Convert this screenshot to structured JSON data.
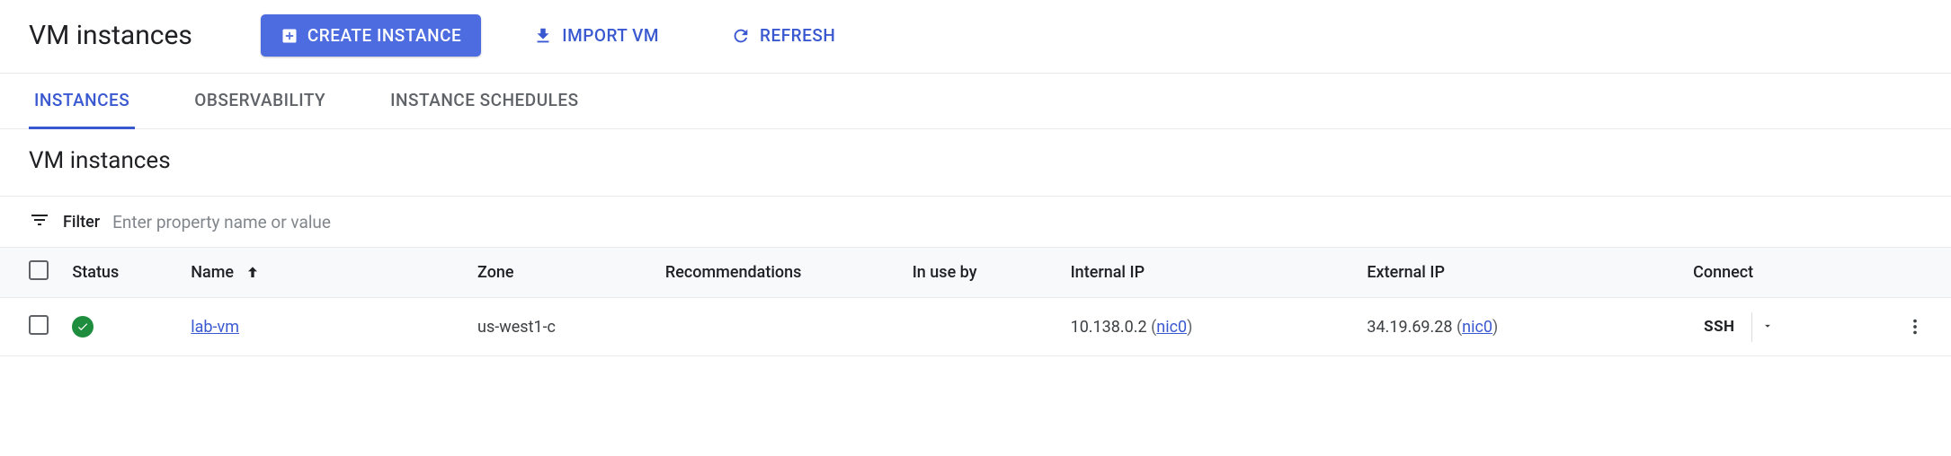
{
  "header": {
    "title": "VM instances",
    "create_label": "CREATE INSTANCE",
    "import_label": "IMPORT VM",
    "refresh_label": "REFRESH"
  },
  "tabs": {
    "instances": "INSTANCES",
    "observability": "OBSERVABILITY",
    "schedules": "INSTANCE SCHEDULES"
  },
  "subheading": "VM instances",
  "filter": {
    "label": "Filter",
    "placeholder": "Enter property name or value"
  },
  "columns": {
    "status": "Status",
    "name": "Name",
    "zone": "Zone",
    "recommendations": "Recommendations",
    "in_use_by": "In use by",
    "internal_ip": "Internal IP",
    "external_ip": "External IP",
    "connect": "Connect"
  },
  "rows": [
    {
      "status": "running",
      "name": "lab-vm",
      "zone": "us-west1-c",
      "recommendations": "",
      "in_use_by": "",
      "internal_ip": "10.138.0.2",
      "internal_nic": "nic0",
      "external_ip": "34.19.69.28",
      "external_nic": "nic0",
      "connect": "SSH"
    }
  ]
}
